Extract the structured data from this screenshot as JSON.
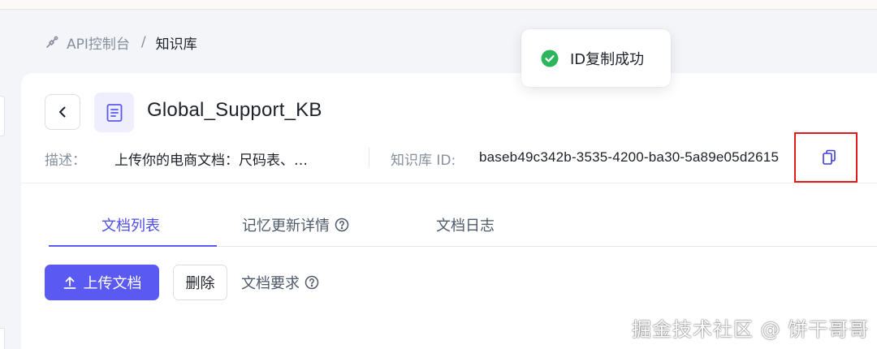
{
  "breadcrumb": {
    "root_label": "API控制台",
    "separator": "/",
    "current_label": "知识库"
  },
  "toast": {
    "message": "ID复制成功",
    "icon": "check-circle-icon",
    "color": "#2db55d"
  },
  "knowledge_base": {
    "title": "Global_Support_KB",
    "description_label": "描述：",
    "description_value": "上传你的电商文档：尺码表、…",
    "id_label": "知识库 ID:",
    "id_value": "baseb49c342b-3535-4200-ba30-5a89e05d2615"
  },
  "tabs": [
    {
      "label": "文档列表",
      "active": true
    },
    {
      "label": "记忆更新详情",
      "active": false,
      "help_icon": true
    },
    {
      "label": "文档日志",
      "active": false
    }
  ],
  "actions": {
    "upload_label": "上传文档",
    "delete_label": "删除",
    "doc_requirements_label": "文档要求"
  },
  "watermark": "掘金技术社区 @ 饼干哥哥",
  "colors": {
    "primary": "#5a5af2",
    "active_tab": "#4e4ee6",
    "highlight": "#e11b1b",
    "muted_text": "#86909c"
  }
}
